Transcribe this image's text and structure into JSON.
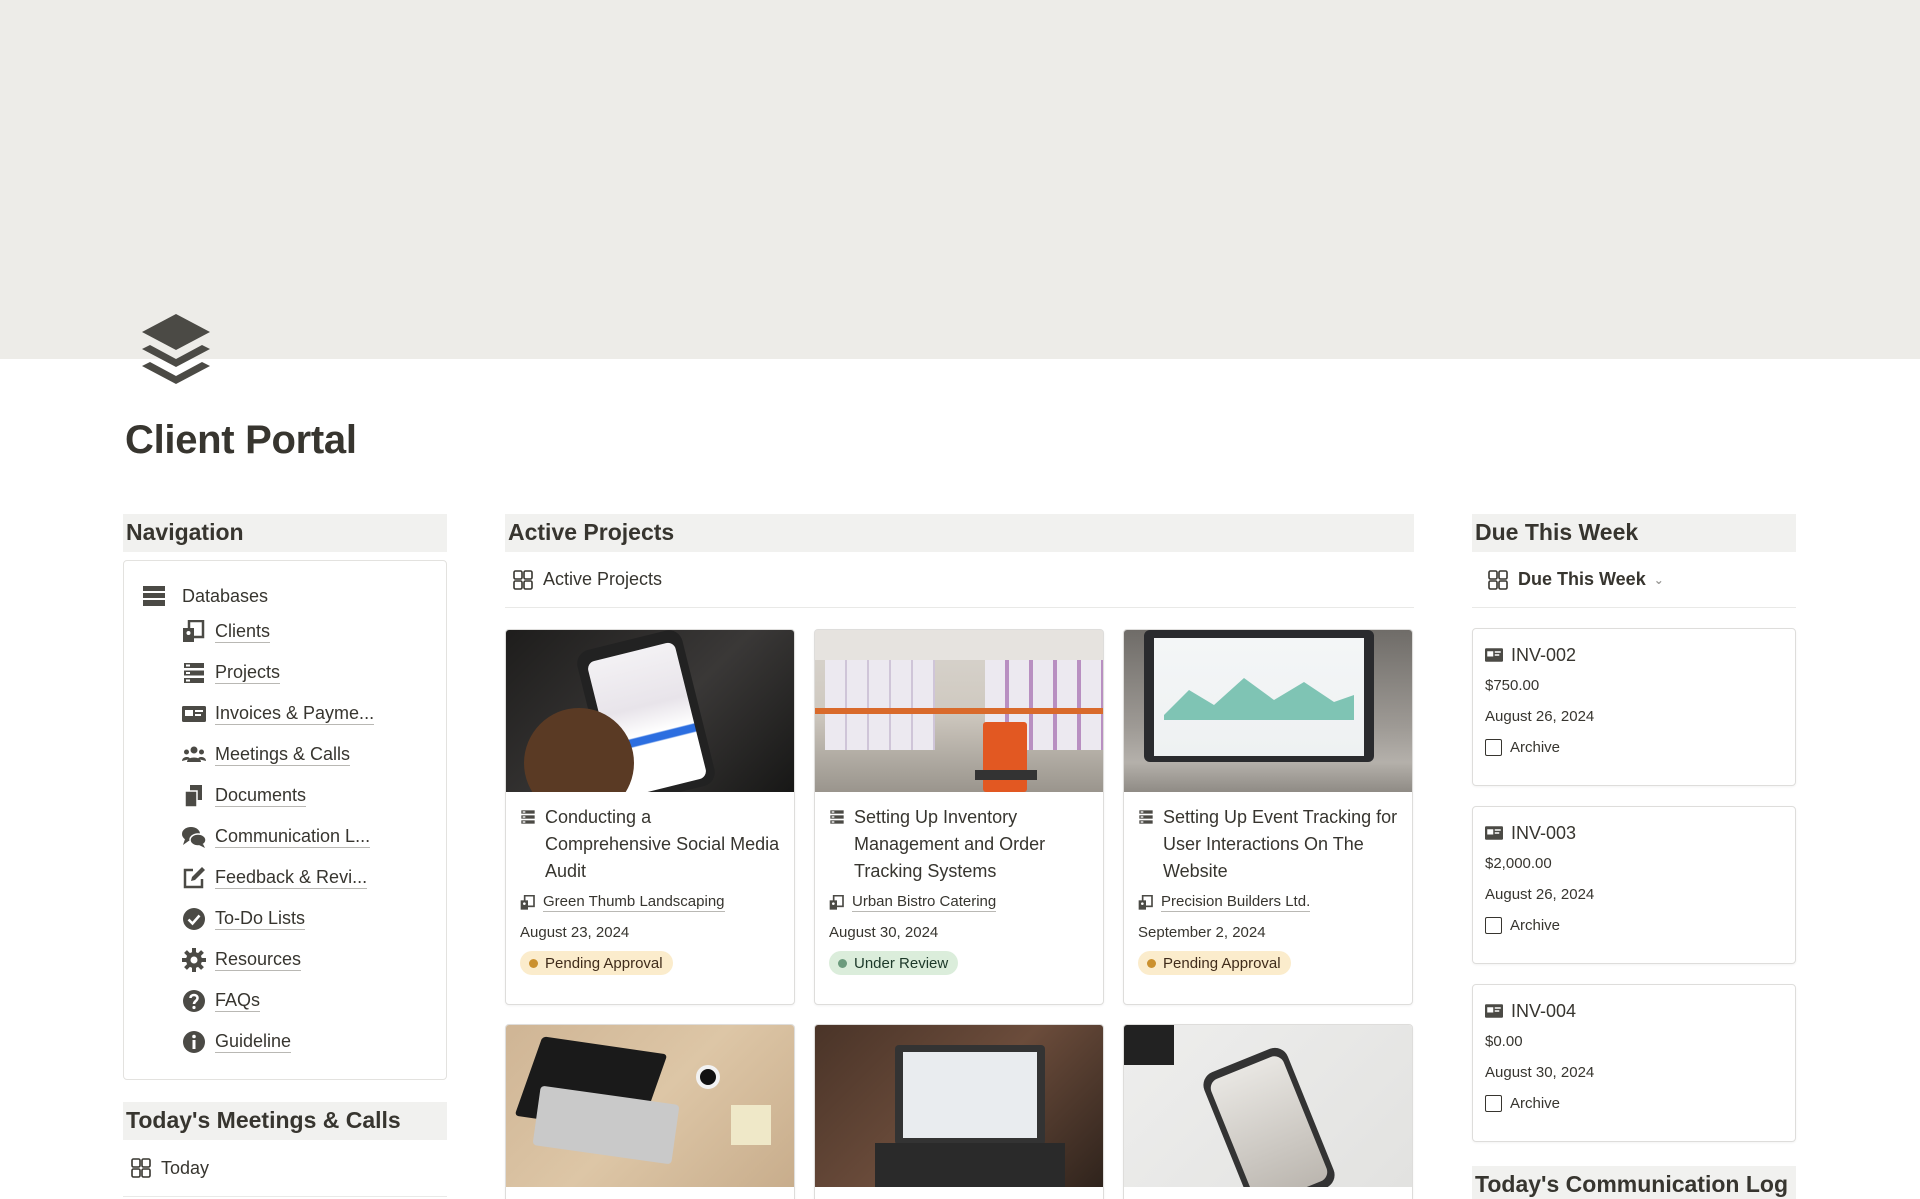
{
  "page": {
    "title": "Client Portal"
  },
  "navigation": {
    "heading": "Navigation",
    "databases_label": "Databases",
    "items": [
      {
        "label": "Clients",
        "icon": "client-card-icon"
      },
      {
        "label": "Projects",
        "icon": "projects-list-icon"
      },
      {
        "label": "Invoices & Payme...",
        "icon": "invoice-card-icon"
      },
      {
        "label": "Meetings & Calls",
        "icon": "people-group-icon"
      },
      {
        "label": "Documents",
        "icon": "documents-icon"
      },
      {
        "label": "Communication L...",
        "icon": "chat-bubbles-icon"
      },
      {
        "label": "Feedback & Revi...",
        "icon": "edit-square-icon"
      },
      {
        "label": "To-Do Lists",
        "icon": "check-circle-icon"
      },
      {
        "label": "Resources",
        "icon": "gear-icon"
      },
      {
        "label": "FAQs",
        "icon": "question-circle-icon"
      },
      {
        "label": "Guideline",
        "icon": "info-circle-icon"
      }
    ]
  },
  "meetings": {
    "heading": "Today's Meetings & Calls",
    "view_label": "Today"
  },
  "projects": {
    "heading": "Active Projects",
    "view_label": "Active Projects",
    "cards": [
      {
        "title": "Conducting a Comprehensive Social Media Audit",
        "client": "Green Thumb Landscaping",
        "date": "August 23, 2024",
        "status": "Pending Approval",
        "status_color": "#cb912f",
        "status_bg": "#fbeccc"
      },
      {
        "title": "Setting Up Inventory Management and Order Tracking Systems",
        "client": "Urban Bistro Catering",
        "date": "August 30, 2024",
        "status": "Under Review",
        "status_color": "#6c9b7d",
        "status_bg": "#dbeddb"
      },
      {
        "title": "Setting Up Event Tracking for User Interactions On The Website",
        "client": "Precision Builders Ltd.",
        "date": "September 2, 2024",
        "status": "Pending Approval",
        "status_color": "#cb912f",
        "status_bg": "#fbeccc"
      }
    ]
  },
  "due": {
    "heading": "Due This Week",
    "view_label": "Due This Week",
    "invoices": [
      {
        "id": "INV-002",
        "amount": "$750.00",
        "date": "August 26, 2024",
        "archive_label": "Archive"
      },
      {
        "id": "INV-003",
        "amount": "$2,000.00",
        "date": "August 26, 2024",
        "archive_label": "Archive"
      },
      {
        "id": "INV-004",
        "amount": "$0.00",
        "date": "August 30, 2024",
        "archive_label": "Archive"
      }
    ]
  },
  "comm_log": {
    "heading": "Today's Communication Log"
  }
}
